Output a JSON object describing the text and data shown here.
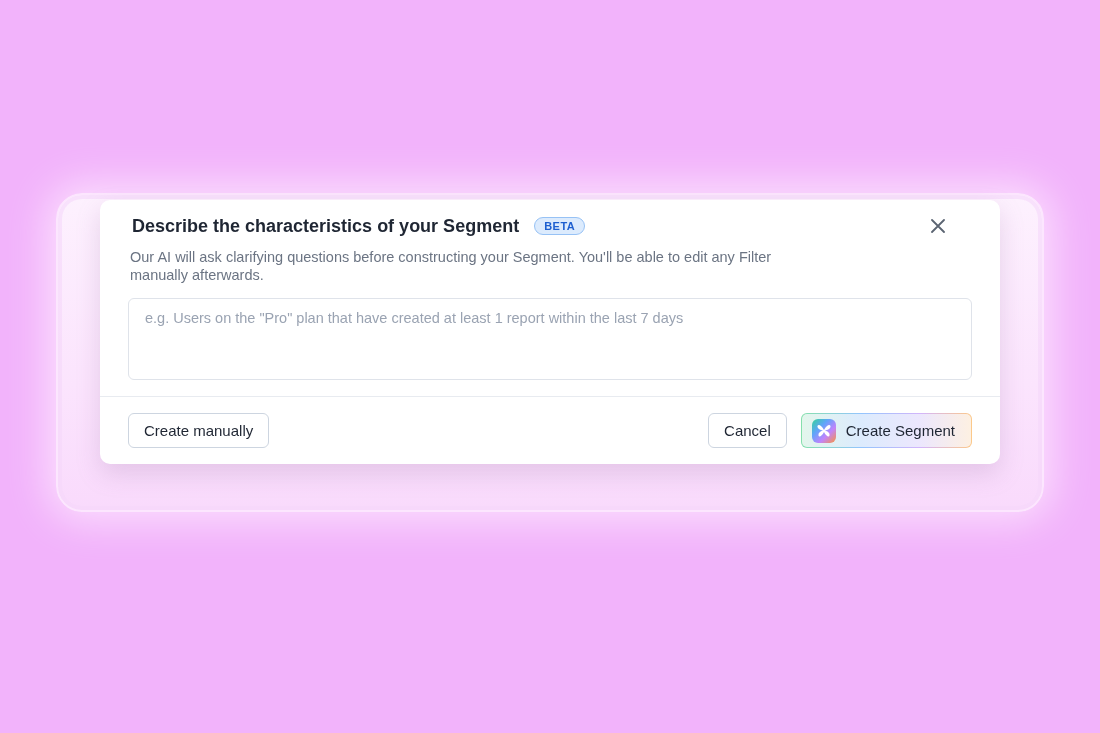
{
  "dialog": {
    "title": "Describe the characteristics of your Segment",
    "badge": "BETA",
    "description": "Our AI will ask clarifying questions before constructing your Segment. You'll be able to edit any Filter manually afterwards.",
    "prompt_field": {
      "placeholder": "e.g. Users on the \"Pro\" plan that have created at least 1 report within the last 7 days"
    },
    "footer": {
      "left_buttons": [
        {
          "label": "Create manually",
          "kind": "secondary"
        }
      ],
      "right_buttons": [
        {
          "label": "Cancel",
          "kind": "secondary"
        },
        {
          "label": "Create Segment",
          "kind": "ai"
        }
      ]
    }
  }
}
